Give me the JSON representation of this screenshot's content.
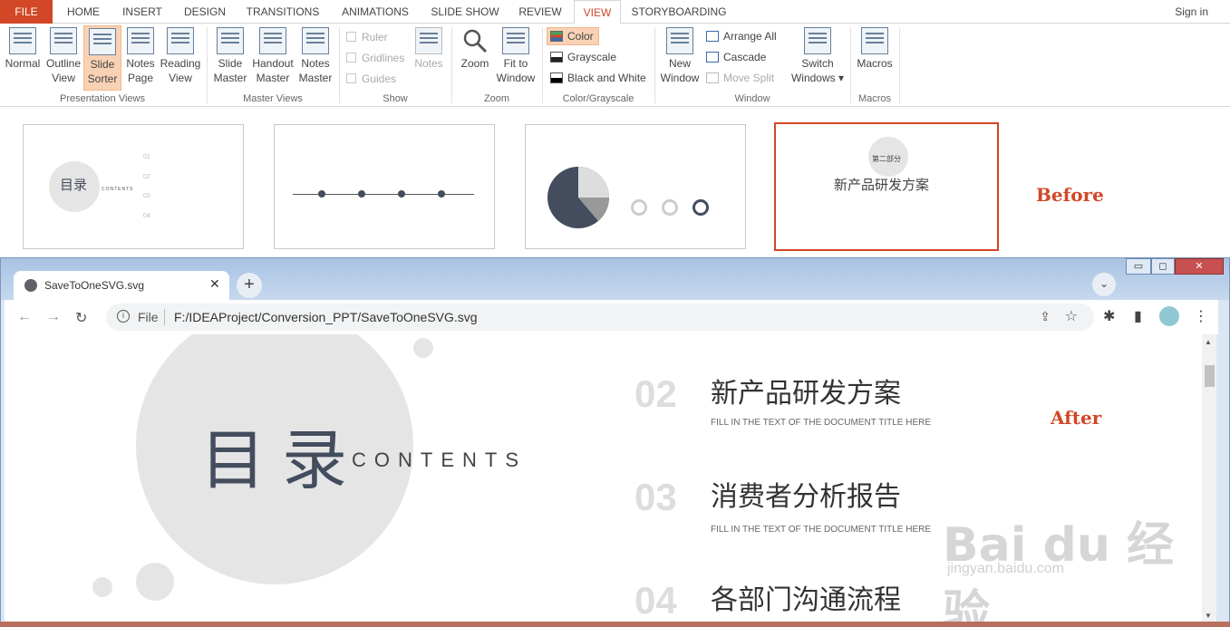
{
  "ribbon_tabs": [
    "FILE",
    "HOME",
    "INSERT",
    "DESIGN",
    "TRANSITIONS",
    "ANIMATIONS",
    "SLIDE SHOW",
    "REVIEW",
    "VIEW",
    "STORYBOARDING"
  ],
  "sign_in": "Sign in",
  "presentation_views": {
    "label": "Presentation Views",
    "buttons": [
      {
        "l1": "Normal",
        "l2": ""
      },
      {
        "l1": "Outline",
        "l2": "View"
      },
      {
        "l1": "Slide",
        "l2": "Sorter"
      },
      {
        "l1": "Notes",
        "l2": "Page"
      },
      {
        "l1": "Reading",
        "l2": "View"
      }
    ]
  },
  "master_views": {
    "label": "Master Views",
    "buttons": [
      {
        "l1": "Slide",
        "l2": "Master"
      },
      {
        "l1": "Handout",
        "l2": "Master"
      },
      {
        "l1": "Notes",
        "l2": "Master"
      }
    ]
  },
  "show": {
    "label": "Show",
    "items": [
      "Ruler",
      "Gridlines",
      "Guides"
    ],
    "notes": "Notes"
  },
  "zoom": {
    "label": "Zoom",
    "zoom": "Zoom",
    "fit1": "Fit to",
    "fit2": "Window"
  },
  "color": {
    "label": "Color/Grayscale",
    "items": [
      "Color",
      "Grayscale",
      "Black and White"
    ]
  },
  "window": {
    "label": "Window",
    "new1": "New",
    "new2": "Window",
    "arrange": "Arrange All",
    "cascade": "Cascade",
    "move": "Move Split",
    "switch1": "Switch",
    "switch2": "Windows"
  },
  "macros": {
    "label": "Macros",
    "button": "Macros"
  },
  "before_label": "Before",
  "thumb1": {
    "title": "目录",
    "sub": "CONTENTS",
    "items": [
      "01",
      "02",
      "03",
      "04"
    ]
  },
  "thumb4": {
    "part": "第二部分",
    "title": "新产品研发方案"
  },
  "browser": {
    "tab_title": "SaveToOneSVG.svg",
    "file_label": "File",
    "url": "F:/IDEAProject/Conversion_PPT/SaveToOneSVG.svg"
  },
  "slide": {
    "title": "目录",
    "contents": "CONTENTS",
    "items": [
      {
        "num": "02",
        "title": "新产品研发方案",
        "sub": "FILL IN THE TEXT OF THE DOCUMENT TITLE HERE"
      },
      {
        "num": "03",
        "title": "消费者分析报告",
        "sub": "FILL IN THE TEXT OF THE DOCUMENT TITLE HERE"
      },
      {
        "num": "04",
        "title": "各部门沟通流程",
        "sub": ""
      }
    ]
  },
  "after_label": "After",
  "watermark": "Bai du 经验",
  "watermark_url": "jingyan.baidu.com",
  "colors": {
    "accent": "#d24726",
    "slide_text": "#434d5e",
    "circle": "#e5e5e5"
  }
}
